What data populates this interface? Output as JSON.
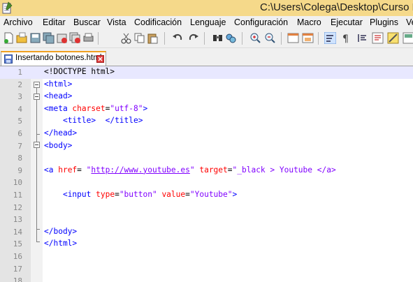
{
  "window": {
    "title": "C:\\Users\\Colega\\Desktop\\Curso H"
  },
  "menu": [
    "Archivo",
    "Editar",
    "Buscar",
    "Vista",
    "Codificación",
    "Lenguaje",
    "Configuración",
    "Macro",
    "Ejecutar",
    "Plugins",
    "Ve"
  ],
  "tab": {
    "label": "Insertando botones.html"
  },
  "editor": {
    "current_line": 1,
    "lines": [
      {
        "n": "1",
        "tokens": [
          {
            "t": "<!DOCTYPE html>",
            "c": "doc"
          }
        ]
      },
      {
        "n": "2",
        "tokens": [
          {
            "t": "<html>",
            "c": "tag"
          }
        ]
      },
      {
        "n": "3",
        "tokens": [
          {
            "t": "<head>",
            "c": "tag"
          }
        ]
      },
      {
        "n": "4",
        "tokens": [
          {
            "t": "<meta ",
            "c": "tag"
          },
          {
            "t": "charset",
            "c": "attr"
          },
          {
            "t": "=",
            "c": "txt"
          },
          {
            "t": "\"utf-8\"",
            "c": "str"
          },
          {
            "t": ">",
            "c": "tag"
          }
        ]
      },
      {
        "n": "5",
        "tokens": [
          {
            "t": "    ",
            "c": "txt"
          },
          {
            "t": "<title>",
            "c": "tag"
          },
          {
            "t": "  ",
            "c": "txt"
          },
          {
            "t": "</title>",
            "c": "tag"
          }
        ]
      },
      {
        "n": "6",
        "tokens": [
          {
            "t": "</head>",
            "c": "tag"
          }
        ]
      },
      {
        "n": "7",
        "tokens": [
          {
            "t": "<body>",
            "c": "tag"
          }
        ]
      },
      {
        "n": "8",
        "tokens": []
      },
      {
        "n": "9",
        "tokens": [
          {
            "t": "<a ",
            "c": "tag"
          },
          {
            "t": "href",
            "c": "attr"
          },
          {
            "t": "= ",
            "c": "txt"
          },
          {
            "t": "\"",
            "c": "str"
          },
          {
            "t": "http://www.youtube.es",
            "c": "link"
          },
          {
            "t": "\"",
            "c": "str"
          },
          {
            "t": " target",
            "c": "attr"
          },
          {
            "t": "=",
            "c": "txt"
          },
          {
            "t": "\"_black > Youtube </a>",
            "c": "str"
          }
        ]
      },
      {
        "n": "10",
        "tokens": []
      },
      {
        "n": "11",
        "tokens": [
          {
            "t": "    ",
            "c": "txt"
          },
          {
            "t": "<input ",
            "c": "tag"
          },
          {
            "t": "type",
            "c": "attr"
          },
          {
            "t": "=",
            "c": "txt"
          },
          {
            "t": "\"button\"",
            "c": "str"
          },
          {
            "t": " value",
            "c": "attr"
          },
          {
            "t": "=",
            "c": "txt"
          },
          {
            "t": "\"Youtube\"",
            "c": "str"
          },
          {
            "t": ">",
            "c": "tag"
          }
        ]
      },
      {
        "n": "12",
        "tokens": []
      },
      {
        "n": "13",
        "tokens": []
      },
      {
        "n": "14",
        "tokens": [
          {
            "t": "</body>",
            "c": "tag"
          }
        ]
      },
      {
        "n": "15",
        "tokens": [
          {
            "t": "</html>",
            "c": "tag"
          }
        ]
      },
      {
        "n": "16",
        "tokens": []
      },
      {
        "n": "17",
        "tokens": []
      },
      {
        "n": "18",
        "tokens": []
      }
    ]
  },
  "toolbar": {
    "icons": [
      "new-file-icon",
      "open-file-icon",
      "save-icon",
      "save-all-icon",
      "close-icon",
      "close-all-icon",
      "print-icon",
      "cut-icon",
      "copy-icon",
      "paste-icon",
      "undo-icon",
      "redo-icon",
      "find-icon",
      "replace-icon",
      "zoom-in-icon",
      "zoom-out-icon",
      "sync-vertical-icon",
      "sync-horizontal-icon",
      "word-wrap-icon",
      "show-all-chars-icon",
      "indent-guide-icon",
      "user-language-icon",
      "doc-map-icon",
      "function-list-icon",
      "monitoring-icon"
    ]
  }
}
